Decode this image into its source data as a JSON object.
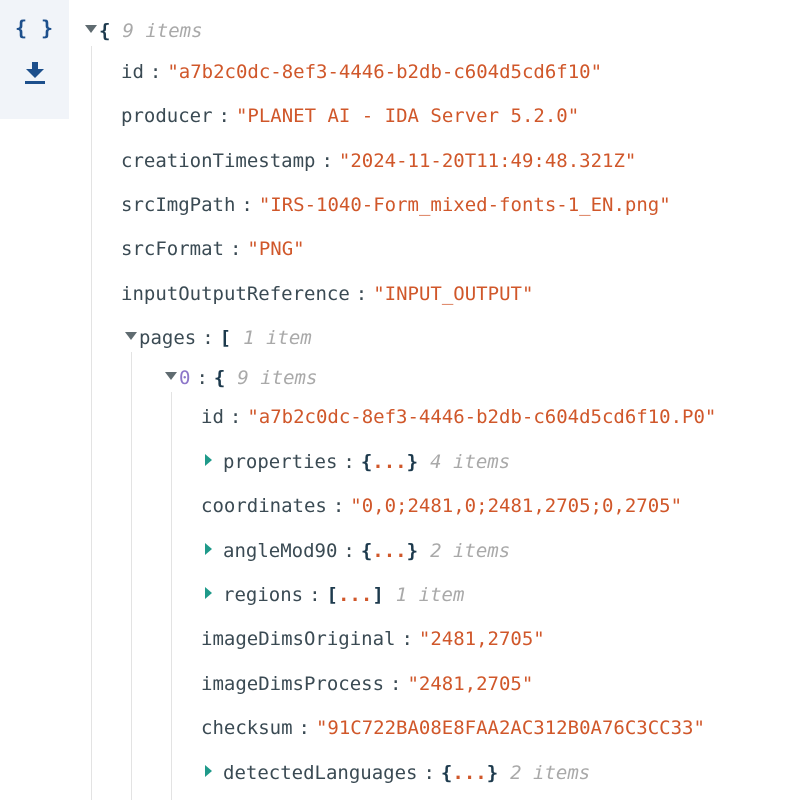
{
  "sidebar": {
    "view_toggle_icon": "{ }",
    "download_icon": "download-icon"
  },
  "root": {
    "open_brace": "{",
    "count": "9 items"
  },
  "fields": [
    {
      "key": "id",
      "value": "\"a7b2c0dc-8ef3-4446-b2db-c604d5cd6f10\""
    },
    {
      "key": "producer",
      "value": "\"PLANET AI - IDA Server 5.2.0\""
    },
    {
      "key": "creationTimestamp",
      "value": "\"2024-11-20T11:49:48.321Z\""
    },
    {
      "key": "srcImgPath",
      "value": "\"IRS-1040-Form_mixed-fonts-1_EN.png\""
    },
    {
      "key": "srcFormat",
      "value": "\"PNG\""
    },
    {
      "key": "inputOutputReference",
      "value": "\"INPUT_OUTPUT\""
    }
  ],
  "pages": {
    "key": "pages",
    "open_bracket": "[",
    "count": "1 item"
  },
  "page0": {
    "key": "0",
    "open_brace": "{",
    "count": "9 items",
    "id": {
      "key": "id",
      "value": "\"a7b2c0dc-8ef3-4446-b2db-c604d5cd6f10.P0\""
    },
    "properties": {
      "key": "properties",
      "open": "{",
      "ellipsis": "...",
      "close": "}",
      "count": "4 items"
    },
    "coordinates": {
      "key": "coordinates",
      "value": "\"0,0;2481,0;2481,2705;0,2705\""
    },
    "angleMod90": {
      "key": "angleMod90",
      "open": "{",
      "ellipsis": "...",
      "close": "}",
      "count": "2 items"
    },
    "regions": {
      "key": "regions",
      "open": "[",
      "ellipsis": "...",
      "close": "]",
      "count": "1 item"
    },
    "imageDimsOriginal": {
      "key": "imageDimsOriginal",
      "value": "\"2481,2705\""
    },
    "imageDimsProcess": {
      "key": "imageDimsProcess",
      "value": "\"2481,2705\""
    },
    "checksum": {
      "key": "checksum",
      "value": "\"91C722BA08E8FAA2AC312B0A76C3CC33\""
    },
    "detectedLanguages": {
      "key": "detectedLanguages",
      "open": "{",
      "ellipsis": "...",
      "close": "}",
      "count": "2 items"
    }
  },
  "colon": ":",
  "colors": {
    "string": "#d0572a",
    "key": "#3a4a53",
    "index": "#8d76c9",
    "collapsed_toggle": "#1f9a8a",
    "count": "#a9a9a9",
    "sidebar_icon": "#1d4f8c"
  }
}
